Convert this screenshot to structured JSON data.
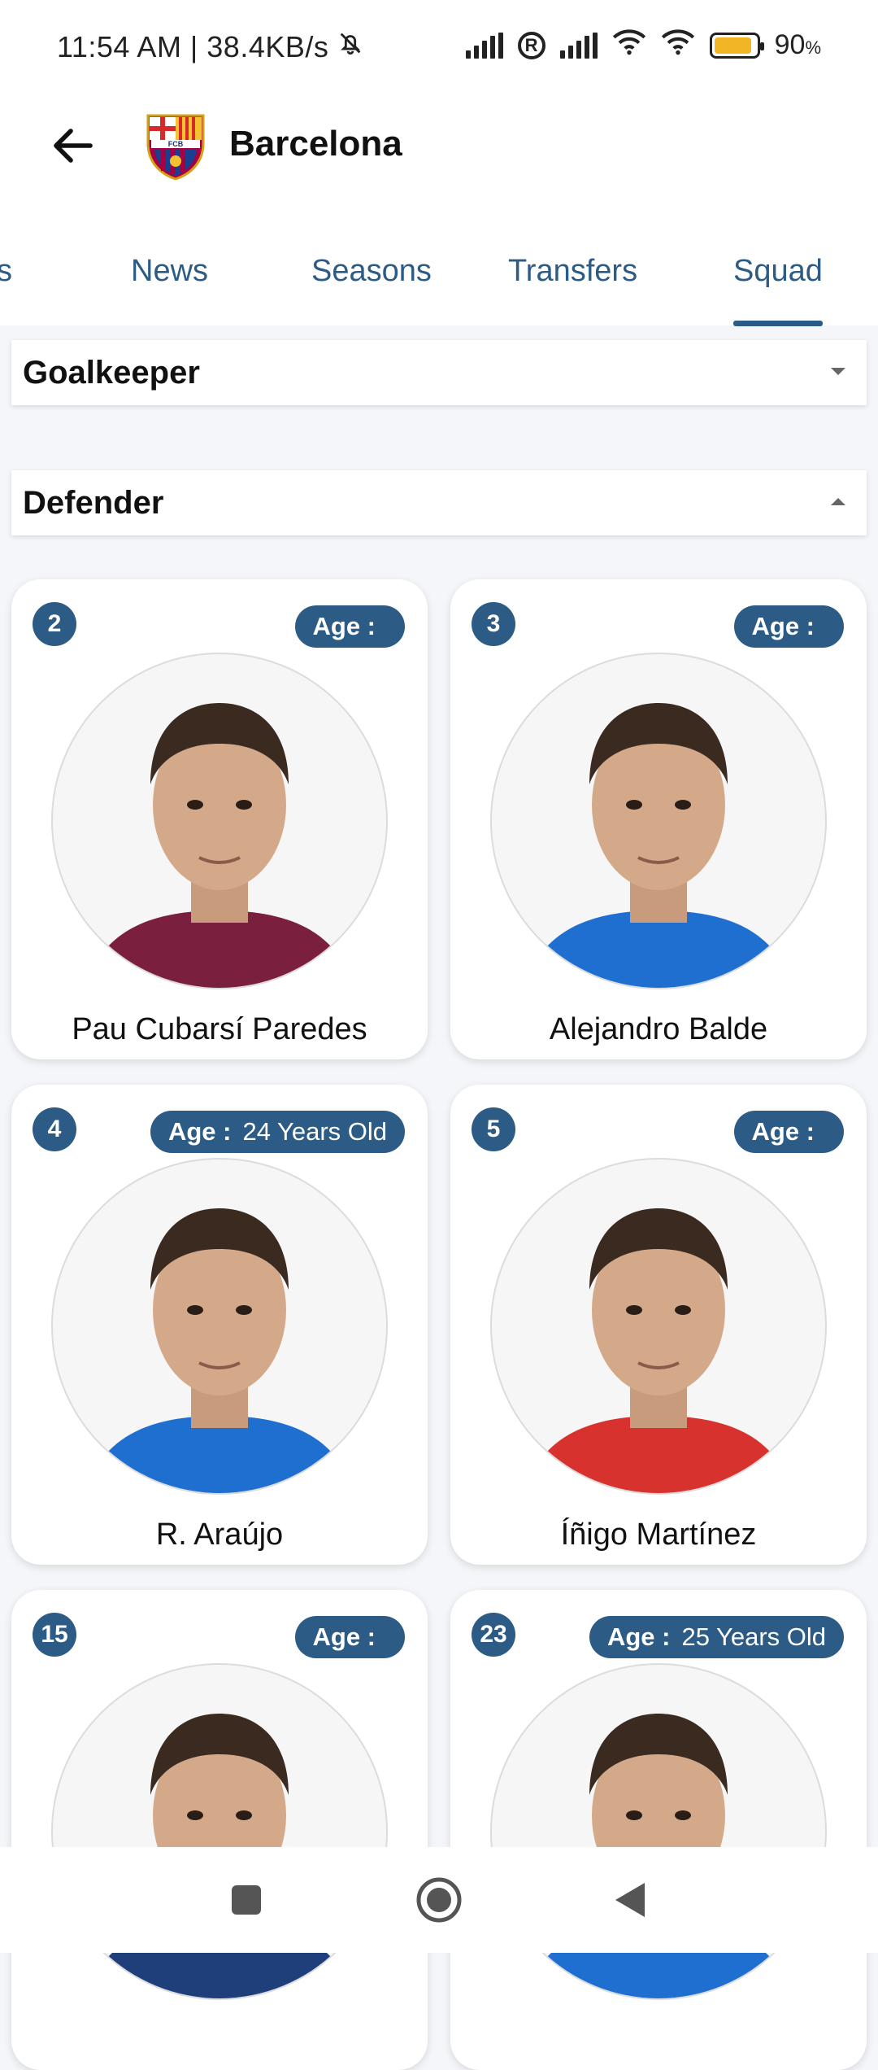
{
  "status_bar": {
    "time_speed": "11:54 AM | 38.4KB/s",
    "battery_percent": "90",
    "battery_suffix": "%",
    "battery_level": 0.9
  },
  "header": {
    "title": "Barcelona",
    "logo_text": "FCB"
  },
  "tabs": [
    {
      "label": "s"
    },
    {
      "label": "News"
    },
    {
      "label": "Seasons"
    },
    {
      "label": "Transfers"
    },
    {
      "label": "Squad",
      "active": true
    }
  ],
  "sections": {
    "goalkeeper": {
      "label": "Goalkeeper",
      "expanded": false
    },
    "defender": {
      "label": "Defender",
      "expanded": true
    }
  },
  "players": [
    {
      "number": "2",
      "age_label": "Age :",
      "age_value": "",
      "name": "Pau Cubarsí Paredes",
      "kit": "#7a1f3d"
    },
    {
      "number": "3",
      "age_label": "Age :",
      "age_value": "",
      "name": "Alejandro Balde",
      "kit": "#1f6fd1"
    },
    {
      "number": "4",
      "age_label": "Age :",
      "age_value": "24 Years Old",
      "name": "R. Araújo",
      "kit": "#1f6fd1"
    },
    {
      "number": "5",
      "age_label": "Age :",
      "age_value": "",
      "name": "Íñigo Martínez",
      "kit": "#d8322f"
    },
    {
      "number": "15",
      "age_label": "Age :",
      "age_value": "",
      "name": "",
      "kit": "#1f3f7a"
    },
    {
      "number": "23",
      "age_label": "Age :",
      "age_value": "25 Years Old",
      "name": "",
      "kit": "#1f6fd1"
    }
  ],
  "colors": {
    "accent": "#2c5b85",
    "background": "#f4f6fa"
  },
  "icons": {
    "back": "arrow-left-icon",
    "recents": "square-icon",
    "home": "circle-icon",
    "nav_back": "triangle-left-icon"
  }
}
